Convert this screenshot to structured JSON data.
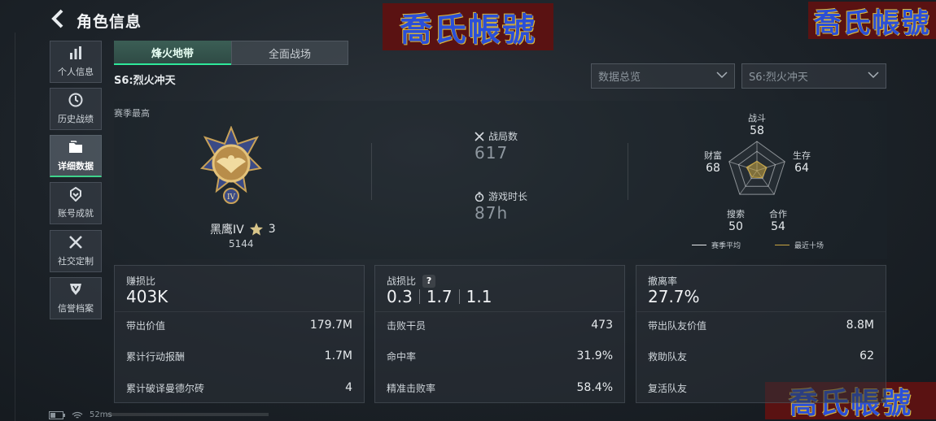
{
  "header": {
    "title": "角色信息",
    "back_icon": "chevron-left-icon"
  },
  "watermark": "喬氏帳號",
  "sidebar": {
    "items": [
      {
        "label": "个人信息",
        "icon": "bar-chart-icon"
      },
      {
        "label": "历史战绩",
        "icon": "clock-icon"
      },
      {
        "label": "详细数据",
        "icon": "folder-icon",
        "active": true
      },
      {
        "label": "账号成就",
        "icon": "medal-icon"
      },
      {
        "label": "社交定制",
        "icon": "tools-icon"
      },
      {
        "label": "信誉档案",
        "icon": "shield-icon"
      }
    ]
  },
  "tabs": [
    {
      "label": "烽火地带",
      "active": true
    },
    {
      "label": "全面战场",
      "active": false
    }
  ],
  "season_title": "S6:烈火冲天",
  "filters": {
    "mode": {
      "value": "数据总览"
    },
    "season": {
      "value": "S6:烈火冲天"
    }
  },
  "profile": {
    "season_best_label": "赛季最高",
    "rank_name": "黑鹰IV",
    "rank_stars": "3",
    "rank_points": "5144"
  },
  "summary": {
    "matches_label": "战局数",
    "matches_value": "617",
    "playtime_label": "游戏时长",
    "playtime_value": "87h"
  },
  "radar": {
    "axes": [
      {
        "label": "战斗",
        "value": "58"
      },
      {
        "label": "生存",
        "value": "64"
      },
      {
        "label": "合作",
        "value": "54"
      },
      {
        "label": "搜索",
        "value": "50"
      },
      {
        "label": "财富",
        "value": "68"
      }
    ],
    "legend": [
      {
        "label": "赛季平均",
        "color": "#e6e9ec"
      },
      {
        "label": "最近十场",
        "color": "#c9a642"
      }
    ]
  },
  "cards": {
    "profit": {
      "title": "赚损比",
      "value": "403K",
      "rows": [
        {
          "label": "带出价值",
          "value": "179.7M"
        },
        {
          "label": "累计行动报酬",
          "value": "1.7M"
        },
        {
          "label": "累计破译曼德尔砖",
          "value": "4"
        }
      ]
    },
    "combat": {
      "title": "战损比",
      "help": "?",
      "ratios": [
        "0.3",
        "1.7",
        "1.1"
      ],
      "rows": [
        {
          "label": "击败干员",
          "value": "473"
        },
        {
          "label": "命中率",
          "value": "31.9%"
        },
        {
          "label": "精准击败率",
          "value": "58.4%"
        }
      ]
    },
    "extract": {
      "title": "撤离率",
      "value": "27.7%",
      "rows": [
        {
          "label": "带出队友价值",
          "value": "8.8M"
        },
        {
          "label": "救助队友",
          "value": "62"
        },
        {
          "label": "复活队友",
          "value": ""
        }
      ]
    }
  },
  "status": {
    "ping": "52ms"
  }
}
